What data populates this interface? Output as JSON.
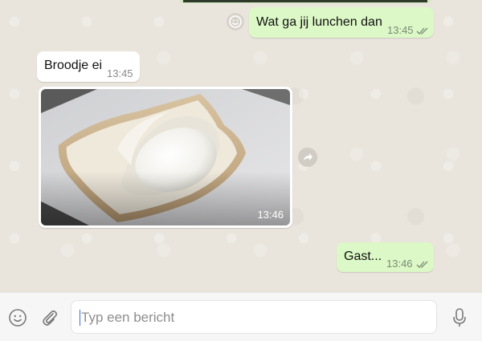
{
  "messages": [
    {
      "direction": "out",
      "text": "Wat ga jij lunchen dan",
      "time": "13:45",
      "status": "read"
    },
    {
      "direction": "in",
      "text": "Broodje ei",
      "time": "13:45"
    },
    {
      "direction": "in",
      "type": "image",
      "image_description": "toast-with-egg-photo",
      "time": "13:46"
    },
    {
      "direction": "out",
      "text": "Gast...",
      "time": "13:46",
      "status": "read"
    }
  ],
  "composer": {
    "placeholder": "Typ een bericht",
    "value": ""
  },
  "icons": {
    "emoji": "smiley-icon",
    "attach": "paperclip-icon",
    "mic": "microphone-icon",
    "forward": "forward-arrow-icon",
    "read": "double-check-icon"
  },
  "colors": {
    "outgoing_bubble": "#dcf8c6",
    "incoming_bubble": "#ffffff",
    "chat_background": "#e9e4dc",
    "read_ticks": "#7a8a76"
  }
}
